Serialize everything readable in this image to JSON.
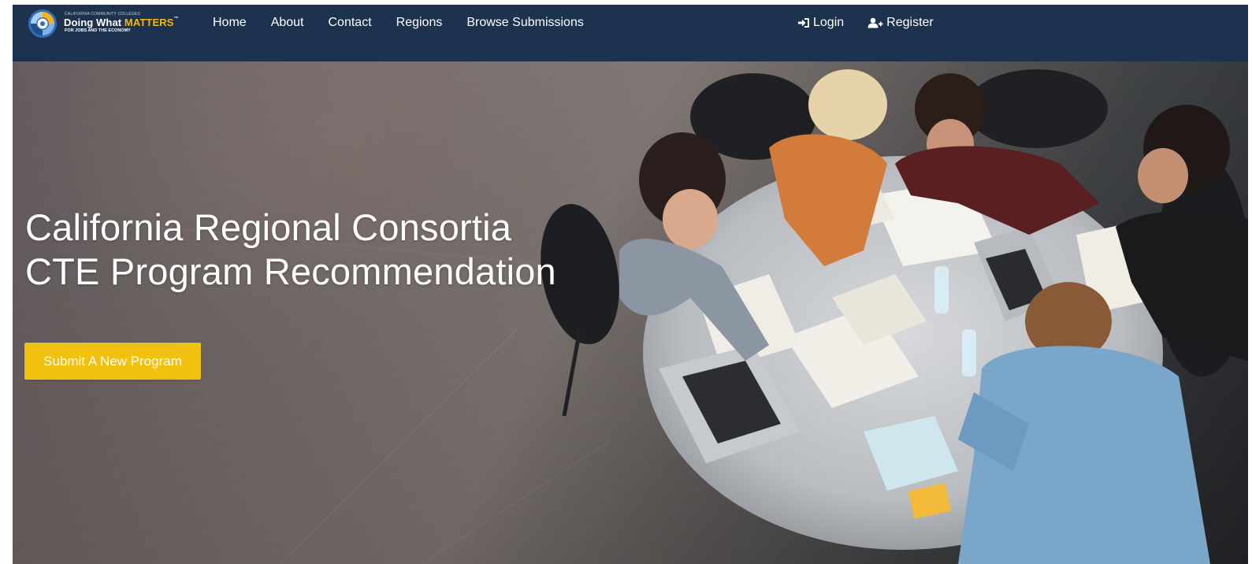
{
  "brand": {
    "super": "California Community Colleges",
    "name_plain": "Doing What ",
    "name_accent": "MATTERS",
    "trademark": "™",
    "tagline": "For Jobs and the Economy"
  },
  "nav": {
    "links": [
      "Home",
      "About",
      "Contact",
      "Regions",
      "Browse Submissions"
    ],
    "login_label": "Login",
    "register_label": "Register"
  },
  "hero": {
    "title_line1": "California Regional Consortia",
    "title_line2": "CTE Program Recommendation",
    "cta_label": "Submit A New Program"
  },
  "colors": {
    "navbar": "#1c324f",
    "accent": "#f6b318",
    "cta": "#f2c00f"
  },
  "icons": {
    "login": "sign-in-icon",
    "register": "user-plus-icon",
    "logo": "swirl-logo-icon"
  }
}
